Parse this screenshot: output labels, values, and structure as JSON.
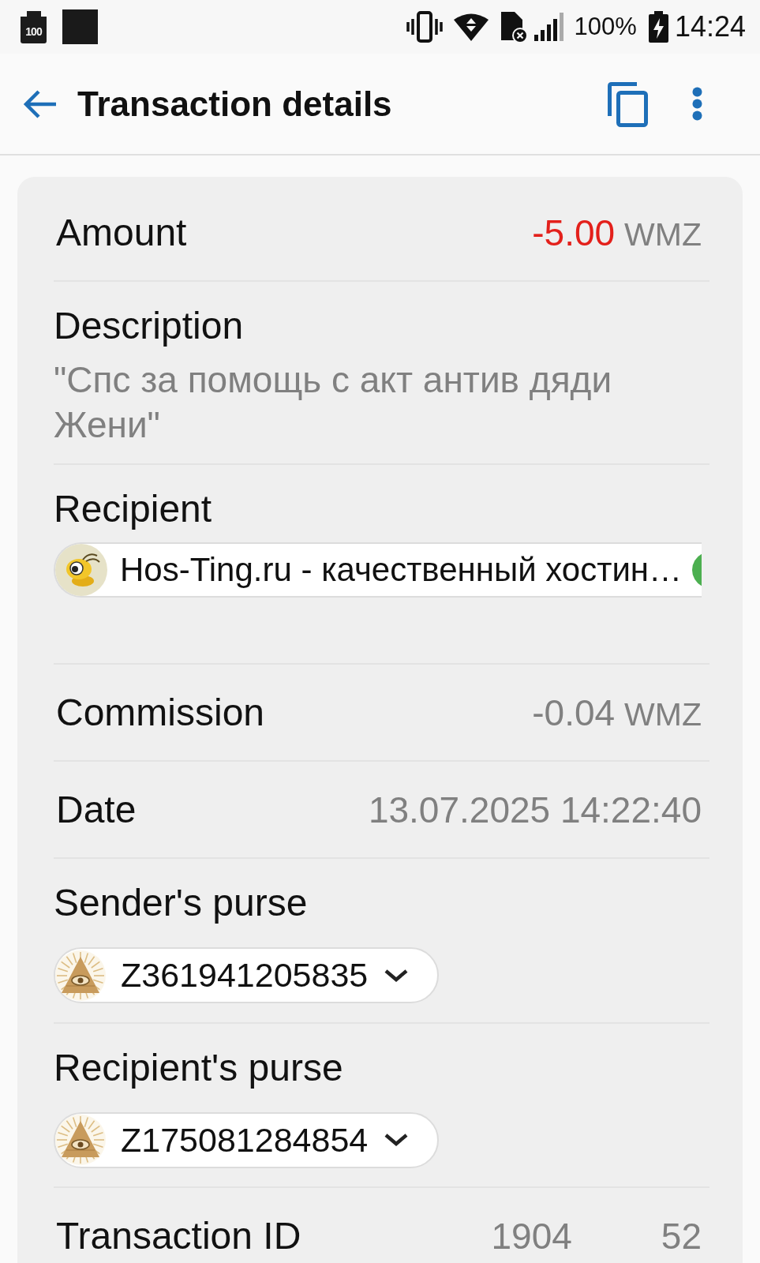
{
  "status_bar": {
    "notification_badge": "100",
    "battery_percent": "100%",
    "time": "14:24"
  },
  "app_bar": {
    "title": "Transaction details"
  },
  "details": [
    {
      "kind": "money",
      "label": "Amount",
      "value": "-5.00",
      "currency": "WMZ",
      "color": "#e3201b"
    },
    {
      "kind": "text",
      "label": "Description",
      "value": "\"Спс за помощь с акт антив дяди Жени\""
    },
    {
      "kind": "contact",
      "label": "Recipient",
      "name": "Hos-Ting.ru - качественный хостин…"
    },
    {
      "kind": "money",
      "label": "Commission",
      "value": "-0.04",
      "currency": "WMZ",
      "color": "#808080"
    },
    {
      "kind": "value",
      "label": "Date",
      "value": "13.07.2025 14:22:40"
    },
    {
      "kind": "purse",
      "label": "Sender's purse",
      "purse": "Z361941205835"
    },
    {
      "kind": "purse",
      "label": "Recipient's purse",
      "purse": "Z175081284854"
    },
    {
      "kind": "split",
      "label": "Transaction ID",
      "parts": [
        "1904",
        "52"
      ]
    }
  ]
}
